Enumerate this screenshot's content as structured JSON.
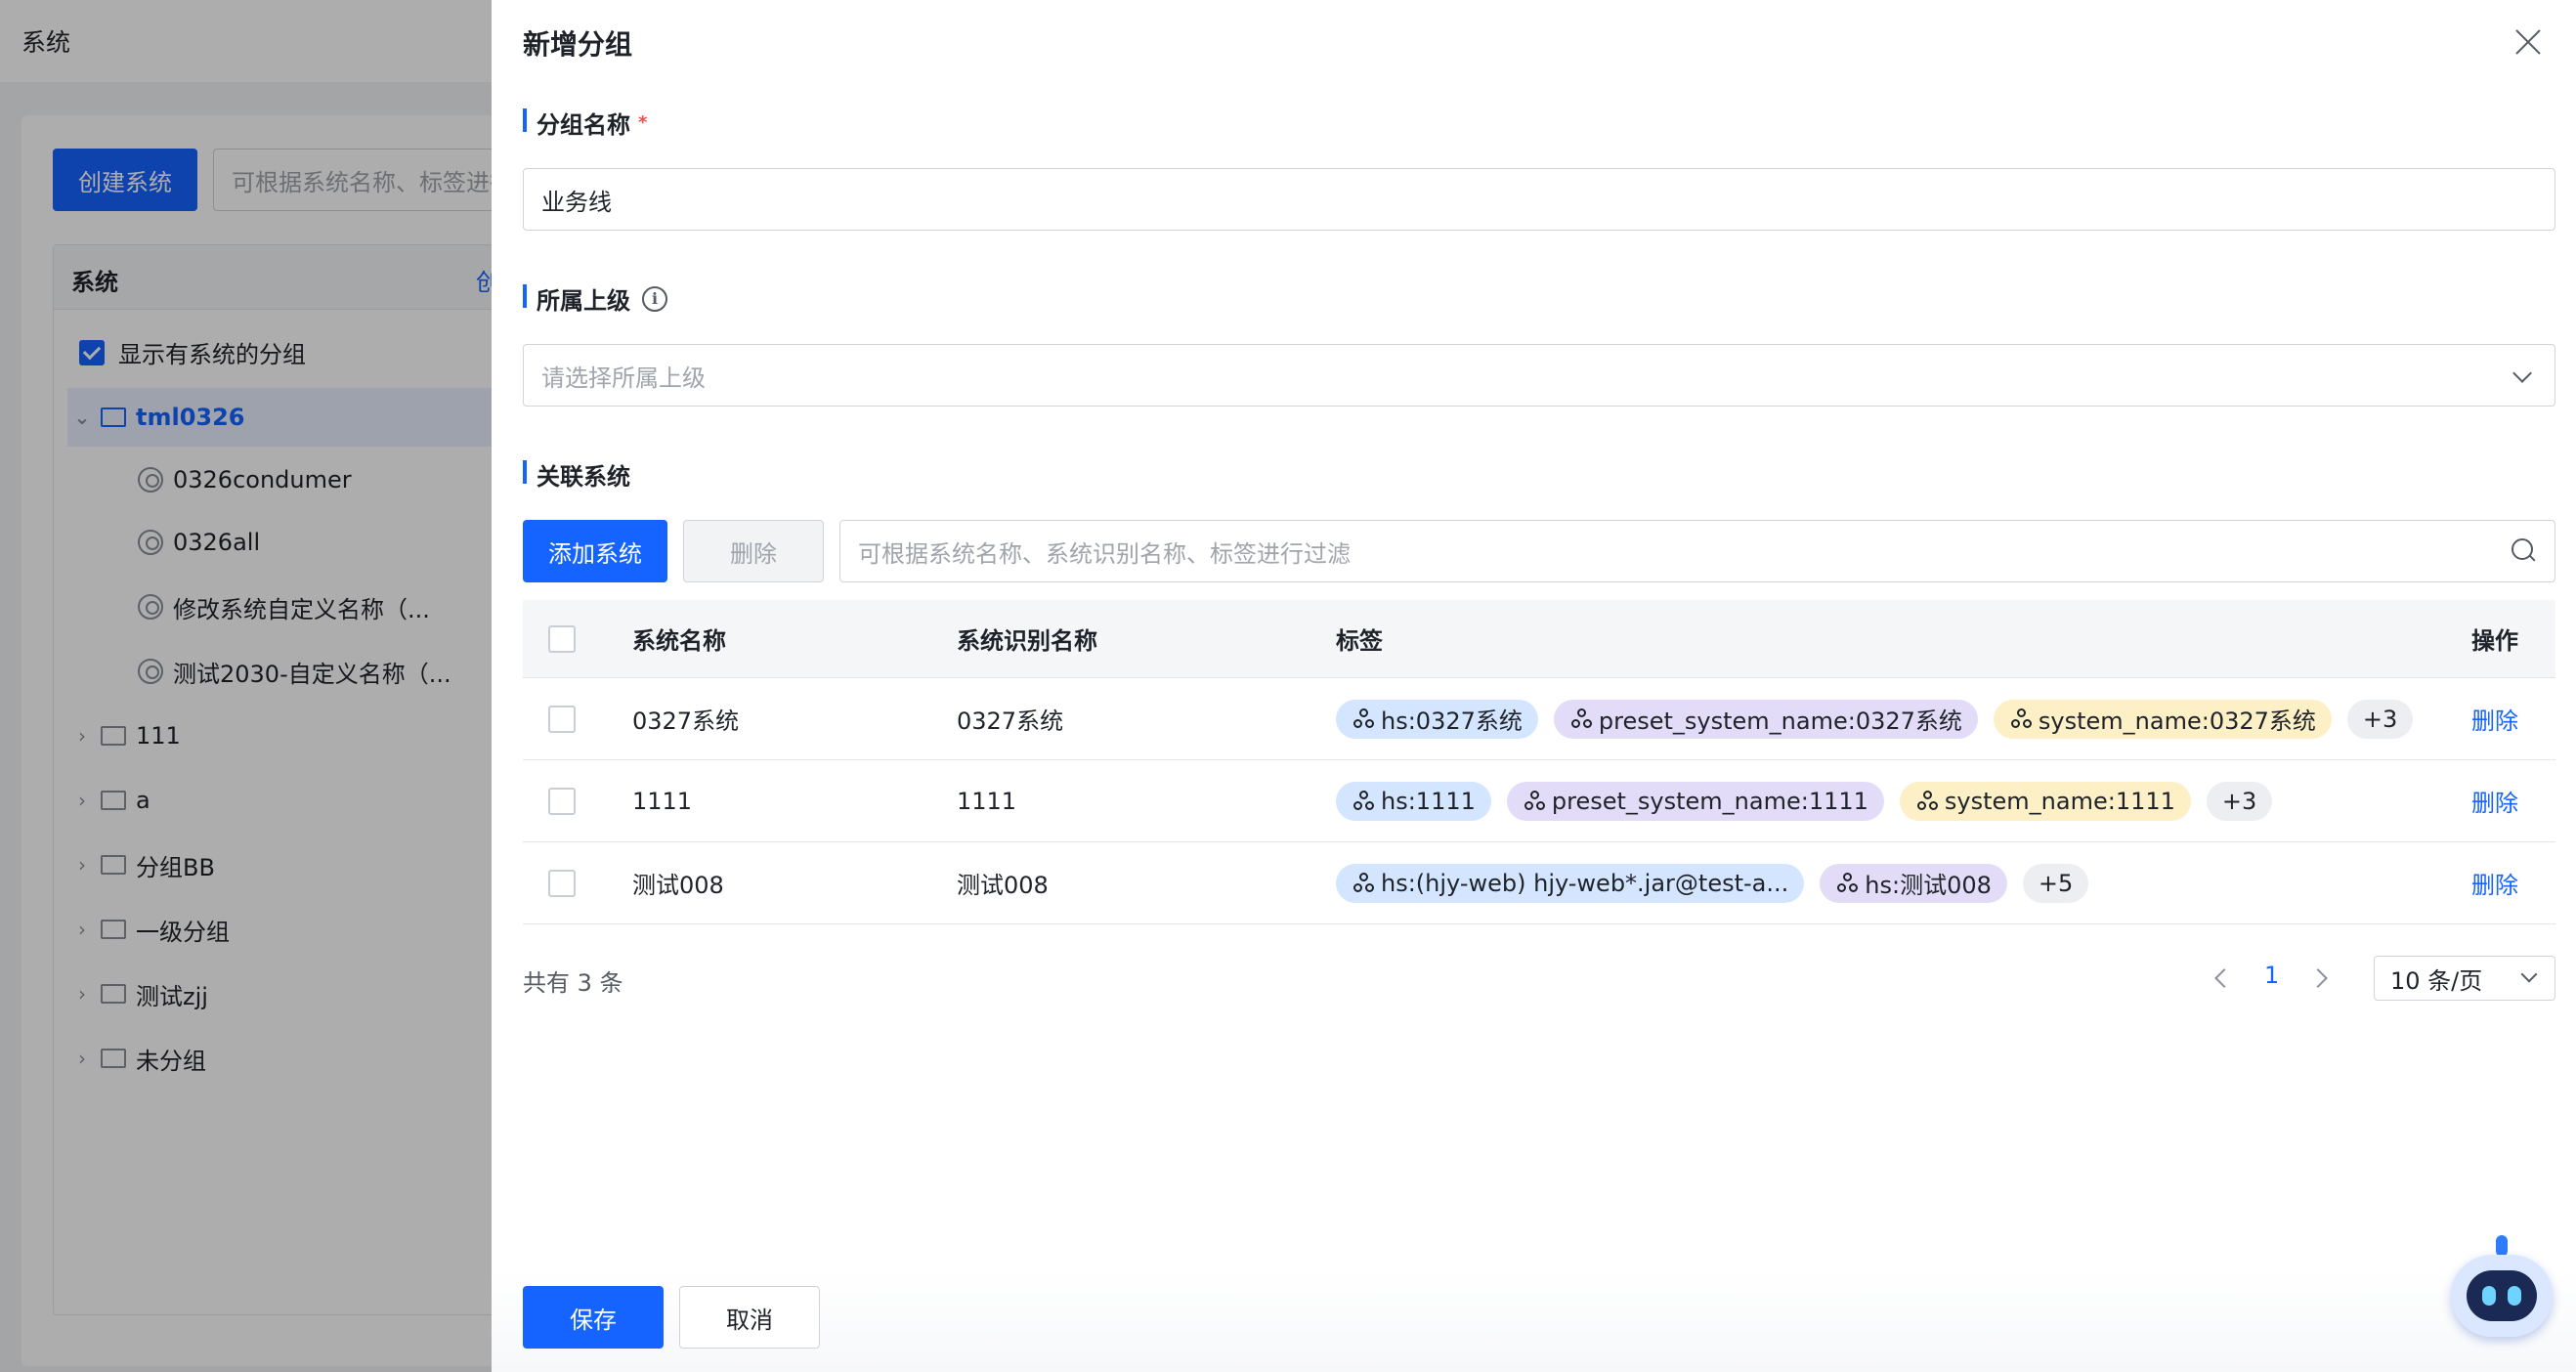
{
  "background": {
    "page_title": "系统",
    "create_button": "创建系统",
    "search_placeholder": "可根据系统名称、标签进行过滤",
    "panel_title": "系统",
    "create_group": "创建分组",
    "show_groups_checkbox": "显示有系统的分组",
    "tree": [
      {
        "label": "tml0326",
        "type": "folder",
        "expanded": true,
        "active": true
      },
      {
        "label": "0326condumer",
        "type": "system"
      },
      {
        "label": "0326all",
        "type": "system"
      },
      {
        "label": "修改系统自定义名称（...",
        "type": "system"
      },
      {
        "label": "测试2030-自定义名称（...",
        "type": "system"
      },
      {
        "label": "111",
        "type": "folder"
      },
      {
        "label": "a",
        "type": "folder"
      },
      {
        "label": "分组BB",
        "type": "folder"
      },
      {
        "label": "一级分组",
        "type": "folder"
      },
      {
        "label": "测试zjj",
        "type": "folder"
      },
      {
        "label": "未分组",
        "type": "folder"
      }
    ]
  },
  "drawer": {
    "title": "新增分组",
    "group_name": {
      "label": "分组名称",
      "required_mark": "*",
      "value": "业务线"
    },
    "parent": {
      "label": "所属上级",
      "placeholder": "请选择所属上级",
      "info_icon": "i"
    },
    "linked": {
      "label": "关联系统",
      "add_button": "添加系统",
      "delete_button": "删除",
      "filter_placeholder": "可根据系统名称、系统识别名称、标签进行过滤",
      "columns": {
        "name": "系统名称",
        "ident": "系统识别名称",
        "tags": "标签",
        "op": "操作"
      },
      "rows": [
        {
          "name": "0327系统",
          "ident": "0327系统",
          "op": "删除",
          "tags": [
            {
              "text": "hs:0327系统",
              "color": "blue"
            },
            {
              "text": "preset_system_name:0327系统",
              "color": "purple"
            },
            {
              "text": "system_name:0327系统",
              "color": "yellow"
            }
          ],
          "more": "+3"
        },
        {
          "name": "1111",
          "ident": "1111",
          "op": "删除",
          "tags": [
            {
              "text": "hs:1111",
              "color": "blue"
            },
            {
              "text": "preset_system_name:1111",
              "color": "purple"
            },
            {
              "text": "system_name:1111",
              "color": "yellow"
            }
          ],
          "more": "+3"
        },
        {
          "name": "测试008",
          "ident": "测试008",
          "op": "删除",
          "tags": [
            {
              "text": "hs:(hjy-web) hjy-web*.jar@test-a...",
              "color": "blue"
            },
            {
              "text": "hs:测试008",
              "color": "purple"
            }
          ],
          "more": "+5"
        }
      ],
      "total": "共有 3 条",
      "current_page": "1",
      "page_size": "10 条/页"
    },
    "save_button": "保存",
    "cancel_button": "取消"
  },
  "colors": {
    "accent": "#1664ff",
    "tag_blue": "#d4e5ff",
    "tag_purple": "#e2dcf9",
    "tag_yellow": "#fdf0c6"
  }
}
